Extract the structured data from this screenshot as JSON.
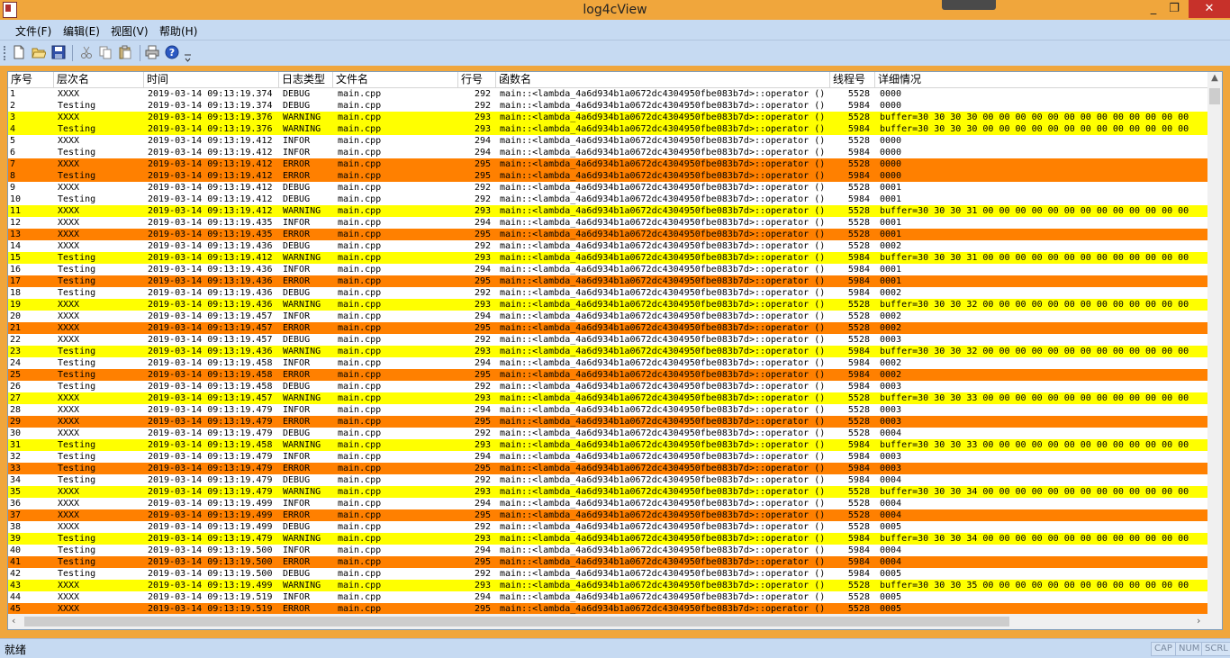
{
  "window": {
    "title": "log4cView",
    "minimize": "_",
    "maximize": "❐",
    "close": "✕"
  },
  "menu": [
    "文件(F)",
    "编辑(E)",
    "视图(V)",
    "帮助(H)"
  ],
  "toolbar": [
    "new-file-icon",
    "open-folder-icon",
    "save-icon",
    "cut-icon",
    "copy-icon",
    "paste-icon",
    "print-icon",
    "help-icon"
  ],
  "columns": [
    "序号",
    "层次名",
    "时间",
    "日志类型",
    "文件名",
    "行号",
    "函数名",
    "线程号",
    "详细情况"
  ],
  "func": "main::<lambda_4a6d934b1a0672dc4304950fbe083b7d>::operator ()",
  "colors": {
    "WARNING": "#ffff00",
    "ERROR": "#ff8000",
    "chrome": "#c6daf2",
    "title": "#f0a63c"
  },
  "rows": [
    [
      "1",
      "XXXX",
      "2019-03-14 09:13:19.374",
      "DEBUG",
      "main.cpp",
      "292",
      "5528",
      "0000"
    ],
    [
      "2",
      "Testing",
      "2019-03-14 09:13:19.374",
      "DEBUG",
      "main.cpp",
      "292",
      "5984",
      "0000"
    ],
    [
      "3",
      "XXXX",
      "2019-03-14 09:13:19.376",
      "WARNING",
      "main.cpp",
      "293",
      "5528",
      "buffer=30 30 30 30 00 00 00 00 00 00 00 00 00 00 00 00 00"
    ],
    [
      "4",
      "Testing",
      "2019-03-14 09:13:19.376",
      "WARNING",
      "main.cpp",
      "293",
      "5984",
      "buffer=30 30 30 30 00 00 00 00 00 00 00 00 00 00 00 00 00"
    ],
    [
      "5",
      "XXXX",
      "2019-03-14 09:13:19.412",
      "INFOR",
      "main.cpp",
      "294",
      "5528",
      "0000"
    ],
    [
      "6",
      "Testing",
      "2019-03-14 09:13:19.412",
      "INFOR",
      "main.cpp",
      "294",
      "5984",
      "0000"
    ],
    [
      "7",
      "XXXX",
      "2019-03-14 09:13:19.412",
      "ERROR",
      "main.cpp",
      "295",
      "5528",
      "0000"
    ],
    [
      "8",
      "Testing",
      "2019-03-14 09:13:19.412",
      "ERROR",
      "main.cpp",
      "295",
      "5984",
      "0000"
    ],
    [
      "9",
      "XXXX",
      "2019-03-14 09:13:19.412",
      "DEBUG",
      "main.cpp",
      "292",
      "5528",
      "0001"
    ],
    [
      "10",
      "Testing",
      "2019-03-14 09:13:19.412",
      "DEBUG",
      "main.cpp",
      "292",
      "5984",
      "0001"
    ],
    [
      "11",
      "XXXX",
      "2019-03-14 09:13:19.412",
      "WARNING",
      "main.cpp",
      "293",
      "5528",
      "buffer=30 30 30 31 00 00 00 00 00 00 00 00 00 00 00 00 00"
    ],
    [
      "12",
      "XXXX",
      "2019-03-14 09:13:19.435",
      "INFOR",
      "main.cpp",
      "294",
      "5528",
      "0001"
    ],
    [
      "13",
      "XXXX",
      "2019-03-14 09:13:19.435",
      "ERROR",
      "main.cpp",
      "295",
      "5528",
      "0001"
    ],
    [
      "14",
      "XXXX",
      "2019-03-14 09:13:19.436",
      "DEBUG",
      "main.cpp",
      "292",
      "5528",
      "0002"
    ],
    [
      "15",
      "Testing",
      "2019-03-14 09:13:19.412",
      "WARNING",
      "main.cpp",
      "293",
      "5984",
      "buffer=30 30 30 31 00 00 00 00 00 00 00 00 00 00 00 00 00"
    ],
    [
      "16",
      "Testing",
      "2019-03-14 09:13:19.436",
      "INFOR",
      "main.cpp",
      "294",
      "5984",
      "0001"
    ],
    [
      "17",
      "Testing",
      "2019-03-14 09:13:19.436",
      "ERROR",
      "main.cpp",
      "295",
      "5984",
      "0001"
    ],
    [
      "18",
      "Testing",
      "2019-03-14 09:13:19.436",
      "DEBUG",
      "main.cpp",
      "292",
      "5984",
      "0002"
    ],
    [
      "19",
      "XXXX",
      "2019-03-14 09:13:19.436",
      "WARNING",
      "main.cpp",
      "293",
      "5528",
      "buffer=30 30 30 32 00 00 00 00 00 00 00 00 00 00 00 00 00"
    ],
    [
      "20",
      "XXXX",
      "2019-03-14 09:13:19.457",
      "INFOR",
      "main.cpp",
      "294",
      "5528",
      "0002"
    ],
    [
      "21",
      "XXXX",
      "2019-03-14 09:13:19.457",
      "ERROR",
      "main.cpp",
      "295",
      "5528",
      "0002"
    ],
    [
      "22",
      "XXXX",
      "2019-03-14 09:13:19.457",
      "DEBUG",
      "main.cpp",
      "292",
      "5528",
      "0003"
    ],
    [
      "23",
      "Testing",
      "2019-03-14 09:13:19.436",
      "WARNING",
      "main.cpp",
      "293",
      "5984",
      "buffer=30 30 30 32 00 00 00 00 00 00 00 00 00 00 00 00 00"
    ],
    [
      "24",
      "Testing",
      "2019-03-14 09:13:19.458",
      "INFOR",
      "main.cpp",
      "294",
      "5984",
      "0002"
    ],
    [
      "25",
      "Testing",
      "2019-03-14 09:13:19.458",
      "ERROR",
      "main.cpp",
      "295",
      "5984",
      "0002"
    ],
    [
      "26",
      "Testing",
      "2019-03-14 09:13:19.458",
      "DEBUG",
      "main.cpp",
      "292",
      "5984",
      "0003"
    ],
    [
      "27",
      "XXXX",
      "2019-03-14 09:13:19.457",
      "WARNING",
      "main.cpp",
      "293",
      "5528",
      "buffer=30 30 30 33 00 00 00 00 00 00 00 00 00 00 00 00 00"
    ],
    [
      "28",
      "XXXX",
      "2019-03-14 09:13:19.479",
      "INFOR",
      "main.cpp",
      "294",
      "5528",
      "0003"
    ],
    [
      "29",
      "XXXX",
      "2019-03-14 09:13:19.479",
      "ERROR",
      "main.cpp",
      "295",
      "5528",
      "0003"
    ],
    [
      "30",
      "XXXX",
      "2019-03-14 09:13:19.479",
      "DEBUG",
      "main.cpp",
      "292",
      "5528",
      "0004"
    ],
    [
      "31",
      "Testing",
      "2019-03-14 09:13:19.458",
      "WARNING",
      "main.cpp",
      "293",
      "5984",
      "buffer=30 30 30 33 00 00 00 00 00 00 00 00 00 00 00 00 00"
    ],
    [
      "32",
      "Testing",
      "2019-03-14 09:13:19.479",
      "INFOR",
      "main.cpp",
      "294",
      "5984",
      "0003"
    ],
    [
      "33",
      "Testing",
      "2019-03-14 09:13:19.479",
      "ERROR",
      "main.cpp",
      "295",
      "5984",
      "0003"
    ],
    [
      "34",
      "Testing",
      "2019-03-14 09:13:19.479",
      "DEBUG",
      "main.cpp",
      "292",
      "5984",
      "0004"
    ],
    [
      "35",
      "XXXX",
      "2019-03-14 09:13:19.479",
      "WARNING",
      "main.cpp",
      "293",
      "5528",
      "buffer=30 30 30 34 00 00 00 00 00 00 00 00 00 00 00 00 00"
    ],
    [
      "36",
      "XXXX",
      "2019-03-14 09:13:19.499",
      "INFOR",
      "main.cpp",
      "294",
      "5528",
      "0004"
    ],
    [
      "37",
      "XXXX",
      "2019-03-14 09:13:19.499",
      "ERROR",
      "main.cpp",
      "295",
      "5528",
      "0004"
    ],
    [
      "38",
      "XXXX",
      "2019-03-14 09:13:19.499",
      "DEBUG",
      "main.cpp",
      "292",
      "5528",
      "0005"
    ],
    [
      "39",
      "Testing",
      "2019-03-14 09:13:19.479",
      "WARNING",
      "main.cpp",
      "293",
      "5984",
      "buffer=30 30 30 34 00 00 00 00 00 00 00 00 00 00 00 00 00"
    ],
    [
      "40",
      "Testing",
      "2019-03-14 09:13:19.500",
      "INFOR",
      "main.cpp",
      "294",
      "5984",
      "0004"
    ],
    [
      "41",
      "Testing",
      "2019-03-14 09:13:19.500",
      "ERROR",
      "main.cpp",
      "295",
      "5984",
      "0004"
    ],
    [
      "42",
      "Testing",
      "2019-03-14 09:13:19.500",
      "DEBUG",
      "main.cpp",
      "292",
      "5984",
      "0005"
    ],
    [
      "43",
      "XXXX",
      "2019-03-14 09:13:19.499",
      "WARNING",
      "main.cpp",
      "293",
      "5528",
      "buffer=30 30 30 35 00 00 00 00 00 00 00 00 00 00 00 00 00"
    ],
    [
      "44",
      "XXXX",
      "2019-03-14 09:13:19.519",
      "INFOR",
      "main.cpp",
      "294",
      "5528",
      "0005"
    ],
    [
      "45",
      "XXXX",
      "2019-03-14 09:13:19.519",
      "ERROR",
      "main.cpp",
      "295",
      "5528",
      "0005"
    ]
  ],
  "status": {
    "text": "就绪",
    "cap": "CAP",
    "num": "NUM",
    "scrl": "SCRL"
  }
}
